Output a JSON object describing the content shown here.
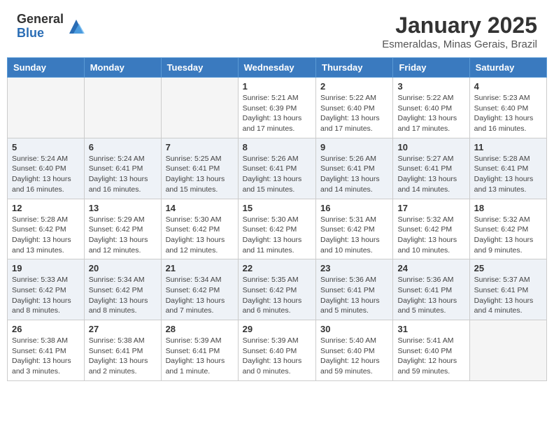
{
  "header": {
    "logo_general": "General",
    "logo_blue": "Blue",
    "month_title": "January 2025",
    "location": "Esmeraldas, Minas Gerais, Brazil"
  },
  "days_of_week": [
    "Sunday",
    "Monday",
    "Tuesday",
    "Wednesday",
    "Thursday",
    "Friday",
    "Saturday"
  ],
  "weeks": [
    [
      {
        "day": "",
        "info": ""
      },
      {
        "day": "",
        "info": ""
      },
      {
        "day": "",
        "info": ""
      },
      {
        "day": "1",
        "info": "Sunrise: 5:21 AM\nSunset: 6:39 PM\nDaylight: 13 hours and 17 minutes."
      },
      {
        "day": "2",
        "info": "Sunrise: 5:22 AM\nSunset: 6:40 PM\nDaylight: 13 hours and 17 minutes."
      },
      {
        "day": "3",
        "info": "Sunrise: 5:22 AM\nSunset: 6:40 PM\nDaylight: 13 hours and 17 minutes."
      },
      {
        "day": "4",
        "info": "Sunrise: 5:23 AM\nSunset: 6:40 PM\nDaylight: 13 hours and 16 minutes."
      }
    ],
    [
      {
        "day": "5",
        "info": "Sunrise: 5:24 AM\nSunset: 6:40 PM\nDaylight: 13 hours and 16 minutes."
      },
      {
        "day": "6",
        "info": "Sunrise: 5:24 AM\nSunset: 6:41 PM\nDaylight: 13 hours and 16 minutes."
      },
      {
        "day": "7",
        "info": "Sunrise: 5:25 AM\nSunset: 6:41 PM\nDaylight: 13 hours and 15 minutes."
      },
      {
        "day": "8",
        "info": "Sunrise: 5:26 AM\nSunset: 6:41 PM\nDaylight: 13 hours and 15 minutes."
      },
      {
        "day": "9",
        "info": "Sunrise: 5:26 AM\nSunset: 6:41 PM\nDaylight: 13 hours and 14 minutes."
      },
      {
        "day": "10",
        "info": "Sunrise: 5:27 AM\nSunset: 6:41 PM\nDaylight: 13 hours and 14 minutes."
      },
      {
        "day": "11",
        "info": "Sunrise: 5:28 AM\nSunset: 6:41 PM\nDaylight: 13 hours and 13 minutes."
      }
    ],
    [
      {
        "day": "12",
        "info": "Sunrise: 5:28 AM\nSunset: 6:42 PM\nDaylight: 13 hours and 13 minutes."
      },
      {
        "day": "13",
        "info": "Sunrise: 5:29 AM\nSunset: 6:42 PM\nDaylight: 13 hours and 12 minutes."
      },
      {
        "day": "14",
        "info": "Sunrise: 5:30 AM\nSunset: 6:42 PM\nDaylight: 13 hours and 12 minutes."
      },
      {
        "day": "15",
        "info": "Sunrise: 5:30 AM\nSunset: 6:42 PM\nDaylight: 13 hours and 11 minutes."
      },
      {
        "day": "16",
        "info": "Sunrise: 5:31 AM\nSunset: 6:42 PM\nDaylight: 13 hours and 10 minutes."
      },
      {
        "day": "17",
        "info": "Sunrise: 5:32 AM\nSunset: 6:42 PM\nDaylight: 13 hours and 10 minutes."
      },
      {
        "day": "18",
        "info": "Sunrise: 5:32 AM\nSunset: 6:42 PM\nDaylight: 13 hours and 9 minutes."
      }
    ],
    [
      {
        "day": "19",
        "info": "Sunrise: 5:33 AM\nSunset: 6:42 PM\nDaylight: 13 hours and 8 minutes."
      },
      {
        "day": "20",
        "info": "Sunrise: 5:34 AM\nSunset: 6:42 PM\nDaylight: 13 hours and 8 minutes."
      },
      {
        "day": "21",
        "info": "Sunrise: 5:34 AM\nSunset: 6:42 PM\nDaylight: 13 hours and 7 minutes."
      },
      {
        "day": "22",
        "info": "Sunrise: 5:35 AM\nSunset: 6:42 PM\nDaylight: 13 hours and 6 minutes."
      },
      {
        "day": "23",
        "info": "Sunrise: 5:36 AM\nSunset: 6:41 PM\nDaylight: 13 hours and 5 minutes."
      },
      {
        "day": "24",
        "info": "Sunrise: 5:36 AM\nSunset: 6:41 PM\nDaylight: 13 hours and 5 minutes."
      },
      {
        "day": "25",
        "info": "Sunrise: 5:37 AM\nSunset: 6:41 PM\nDaylight: 13 hours and 4 minutes."
      }
    ],
    [
      {
        "day": "26",
        "info": "Sunrise: 5:38 AM\nSunset: 6:41 PM\nDaylight: 13 hours and 3 minutes."
      },
      {
        "day": "27",
        "info": "Sunrise: 5:38 AM\nSunset: 6:41 PM\nDaylight: 13 hours and 2 minutes."
      },
      {
        "day": "28",
        "info": "Sunrise: 5:39 AM\nSunset: 6:41 PM\nDaylight: 13 hours and 1 minute."
      },
      {
        "day": "29",
        "info": "Sunrise: 5:39 AM\nSunset: 6:40 PM\nDaylight: 13 hours and 0 minutes."
      },
      {
        "day": "30",
        "info": "Sunrise: 5:40 AM\nSunset: 6:40 PM\nDaylight: 12 hours and 59 minutes."
      },
      {
        "day": "31",
        "info": "Sunrise: 5:41 AM\nSunset: 6:40 PM\nDaylight: 12 hours and 59 minutes."
      },
      {
        "day": "",
        "info": ""
      }
    ]
  ]
}
